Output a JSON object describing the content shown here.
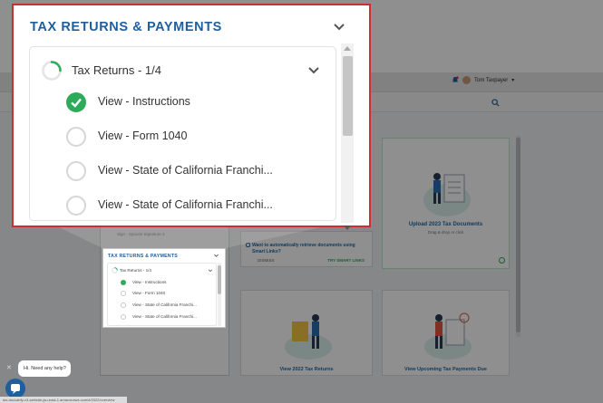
{
  "app": {
    "user_name": "Tom Taxpayer",
    "user_caret": "▾"
  },
  "background_cards": {
    "spouse_signature": "Sign - Spouse Signature 3",
    "smart_links_question": "Want to automatically retrieve documents using Smart Links?",
    "smart_links_dismiss": "DISMISS",
    "smart_links_try": "TRY SMART LINKS",
    "upload_title": "Upload 2023 Tax Documents",
    "upload_subtitle": "Drag & drop or click",
    "view_prior_returns": "View 2022 Tax Returns",
    "view_upcoming_payments": "View Upcoming Tax Payments Due"
  },
  "panel": {
    "title": "TAX RETURNS & PAYMENTS",
    "group_label": "Tax Returns - 1/4",
    "group_progress": 0.25,
    "tasks": [
      {
        "label": "View - Instructions",
        "done": true
      },
      {
        "label": "View - Form 1040",
        "done": false
      },
      {
        "label": "View - State of California Franchi...",
        "done": false
      },
      {
        "label": "View - State of California Franchi...",
        "done": false
      }
    ]
  },
  "mini_panel": {
    "title": "TAX RETURNS & PAYMENTS",
    "group_label": "Tax Returns - 1/4",
    "tasks": [
      "View - Instructions",
      "View - Form 1040",
      "View - State of California Franchi...",
      "View - State of California Franchi..."
    ]
  },
  "help": {
    "chat_text": "Hi. Need any help?",
    "close_glyph": "✕"
  },
  "status_url": "tax-doccabfy-c3-website-jsu-east-1.amazonaws.com/#/2022/overview",
  "colors": {
    "accent_blue": "#1f5f9e",
    "success_green": "#2eaa5b",
    "highlight_red": "#cc2f2f"
  }
}
